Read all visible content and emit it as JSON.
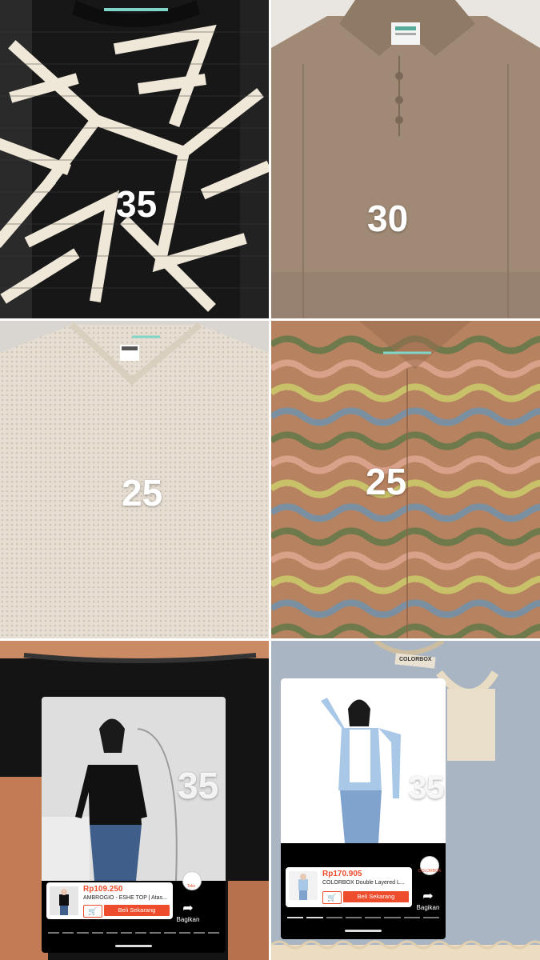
{
  "prices": [
    "35",
    "30",
    "25",
    "25",
    "35",
    "35"
  ],
  "overlays": [
    {
      "price": "Rp109.250",
      "name": "AMBROGIO - ESHE TOP | Atas...",
      "buy_label": "Beli Sekarang",
      "share_label": "Bagikan",
      "avatar_label": "Toko"
    },
    {
      "price": "Rp170.905",
      "name": "COLORBOX Double Layered L...",
      "buy_label": "Beli Sekarang",
      "share_label": "Bagikan",
      "avatar_label": "COLORBOX",
      "garment_brand": "COLORBOX"
    }
  ],
  "colors": {
    "panel1_bg": "#171717",
    "panel1_pattern": "#efe7d8",
    "panel2_bg": "#a08a75",
    "panel3_bg": "#e6ded2",
    "panel4_bg": "#b6825f",
    "panel5_bg": "#141414",
    "panel6_bg": "#a9b5c2",
    "shop_accent": "#ee4d2d"
  }
}
